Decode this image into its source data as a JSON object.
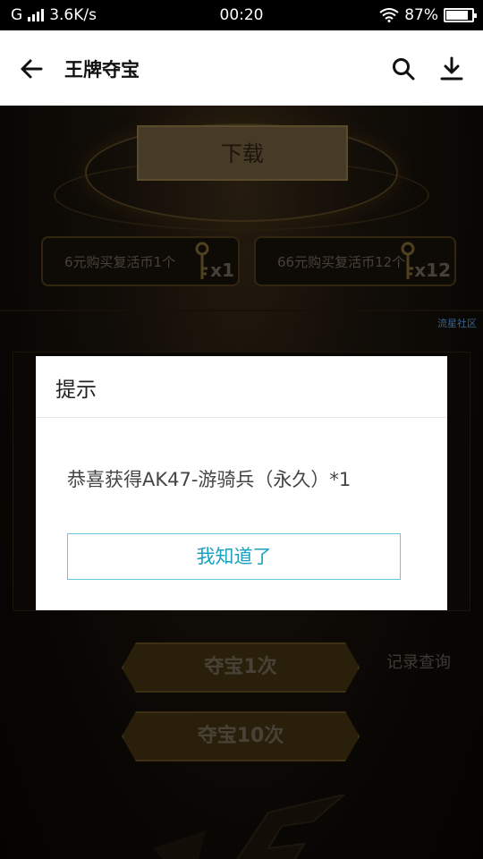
{
  "status_bar": {
    "signal_text": "G",
    "net_speed": "3.6K/s",
    "time": "00:20",
    "battery_percent": "87%",
    "battery_level": 0.87
  },
  "app_bar": {
    "title": "王牌夺宝"
  },
  "game": {
    "download_banner": "下载",
    "offers": [
      {
        "label": "6元购买复活币1个",
        "count": "x1"
      },
      {
        "label": "66元购买复活币12个",
        "count": "x12"
      }
    ],
    "draw_once": "夺宝1次",
    "draw_ten": "夺宝10次",
    "records": "记录查询",
    "watermark": "流星社区"
  },
  "dialog": {
    "title": "提示",
    "message": "恭喜获得AK47-游骑兵（永久）*1",
    "confirm": "我知道了"
  },
  "colors": {
    "accent": "#1aa0c0",
    "button_border": "#62c8dc"
  }
}
